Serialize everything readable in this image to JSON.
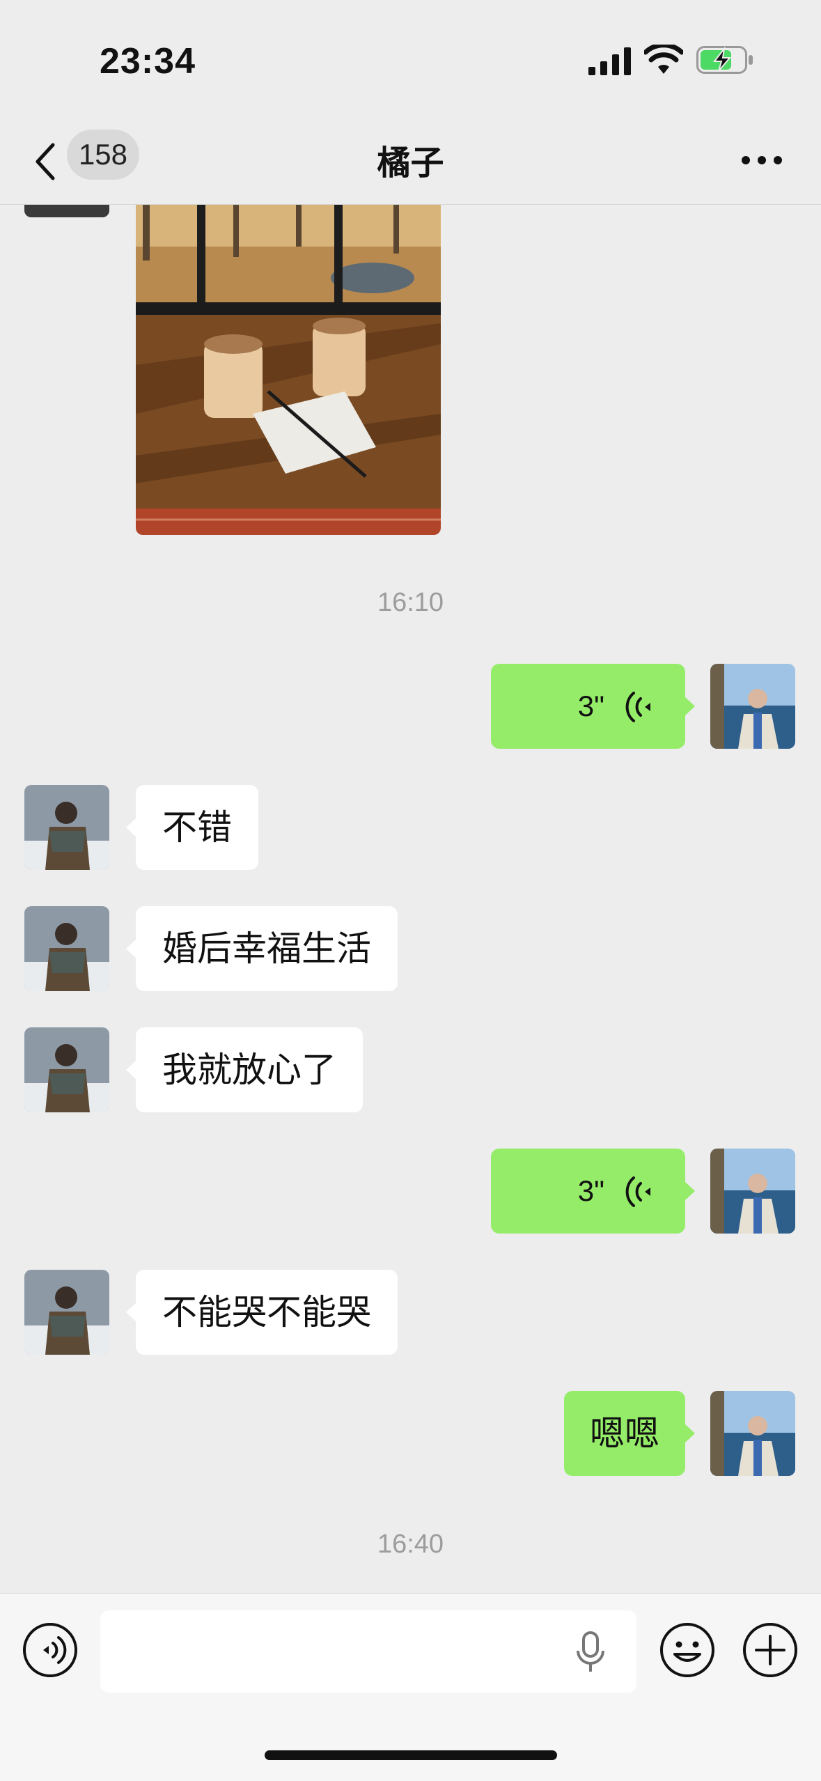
{
  "status_bar": {
    "time": "23:34"
  },
  "nav": {
    "unread_count": "158",
    "title": "橘子"
  },
  "messages": [
    {
      "type": "image",
      "direction": "in",
      "description_icon": "photo"
    },
    {
      "type": "timestamp",
      "text": "16:10"
    },
    {
      "type": "voice",
      "direction": "out",
      "duration": "3\""
    },
    {
      "type": "text",
      "direction": "in",
      "text": "不错"
    },
    {
      "type": "text",
      "direction": "in",
      "text": "婚后幸福生活"
    },
    {
      "type": "text",
      "direction": "in",
      "text": "我就放心了"
    },
    {
      "type": "voice",
      "direction": "out",
      "duration": "3\""
    },
    {
      "type": "text",
      "direction": "in",
      "text": "不能哭不能哭"
    },
    {
      "type": "text",
      "direction": "out",
      "text": "嗯嗯"
    },
    {
      "type": "timestamp",
      "text": "16:40"
    }
  ],
  "input": {
    "value": "",
    "placeholder": ""
  },
  "icons": {
    "back": "chevron-left-icon",
    "more": "more-dots-icon",
    "voice_toggle": "voice-wave-icon",
    "mic": "microphone-icon",
    "emoji": "emoji-icon",
    "plus": "plus-icon"
  },
  "colors": {
    "background": "#ededed",
    "outgoing_bubble": "#95ec69",
    "incoming_bubble": "#ffffff",
    "battery_charge": "#4cd964"
  }
}
